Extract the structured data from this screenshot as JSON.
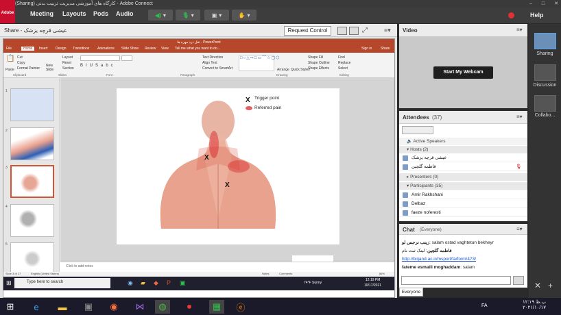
{
  "window": {
    "title": "(Sharing) کارگاه های آموزشی مدیریت تربیت بدنی - Adobe Connect",
    "controls": [
      "–",
      "□",
      "✕"
    ]
  },
  "logo": "Adobe",
  "menu": [
    "Meeting",
    "Layouts",
    "Pods",
    "Audio"
  ],
  "help": "Help",
  "share": {
    "label": "Share",
    "presenter": "عیشی قرچه یزشک",
    "request_control": "Request Control"
  },
  "ppt": {
    "title": "نقل درد مهره ها - PowerPoint",
    "tabs": [
      "File",
      "Home",
      "Insert",
      "Design",
      "Transitions",
      "Animations",
      "Slide Show",
      "Review",
      "View",
      "Tell me what you want to do..."
    ],
    "sign_in": "Sign in",
    "share_btn": "Share",
    "ribbon": {
      "paste": "Paste",
      "cut": "Cut",
      "copy": "Copy",
      "format_painter": "Format Painter",
      "new_slide": "New Slide",
      "layout": "Layout",
      "reset": "Reset",
      "section": "Section",
      "text_direction": "Text Direction",
      "align_text": "Align Text",
      "convert": "Convert to SmartArt",
      "arrange": "Arrange",
      "quick_styles": "Quick Styles",
      "shape_fill": "Shape Fill",
      "shape_outline": "Shape Outline",
      "shape_effects": "Shape Effects",
      "find": "Find",
      "replace": "Replace",
      "select": "Select",
      "groups": [
        "Clipboard",
        "Slides",
        "Font",
        "Paragraph",
        "Drawing",
        "Editing"
      ]
    },
    "thumb_nums": [
      "1",
      "2",
      "3",
      "4",
      "5"
    ],
    "slide": {
      "legend_trigger": "Trigger point",
      "legend_referred": "Referred pain",
      "trigger_mark": "X"
    },
    "notes": "Click to add notes",
    "status": {
      "slide": "Slide 3 of 17",
      "lang": "English (United States)",
      "notes": "Notes",
      "comments": "Comments",
      "zoom": "86%"
    },
    "search": "Type here to search",
    "weather": "74°F  Sunny",
    "time": "12:19 PM",
    "date": "10/17/2021"
  },
  "video": {
    "label": "Video",
    "webcam": "Start My Webcam"
  },
  "attendees": {
    "label": "Attendees",
    "count": "(37)",
    "active_speakers": "Active Speakers",
    "hosts_label": "Hosts (2)",
    "hosts": [
      "عیشی قرچه یزشک",
      "فاطمه گلچین"
    ],
    "presenters_label": "Presenters (0)",
    "participants_label": "Participants (35)",
    "participants": [
      "Amir Rakhshani",
      "Delbaz",
      "faeze noferesti"
    ]
  },
  "chat": {
    "label": "Chat",
    "scope": "(Everyone)",
    "messages": [
      {
        "from": "زینب نرجس ‌لو",
        "text": "salam ostad vaghtetun bekheyr"
      },
      {
        "from": "فاطمه گلچین",
        "text": "لینک ثبت نام",
        "link": "http://birjand.ac.ir/msport/fa/form/473/"
      },
      {
        "from": "fateme esmaili moghaddam",
        "text": "salam"
      }
    ],
    "tab": "Everyone"
  },
  "layouts": [
    "Sharing",
    "Discussion",
    "Collabo..."
  ],
  "taskbar": {
    "lang": "FA",
    "time": "۱۲:۱۹ ب.ظ",
    "date": "۲۰۲۱/۱۰/۱۷"
  }
}
